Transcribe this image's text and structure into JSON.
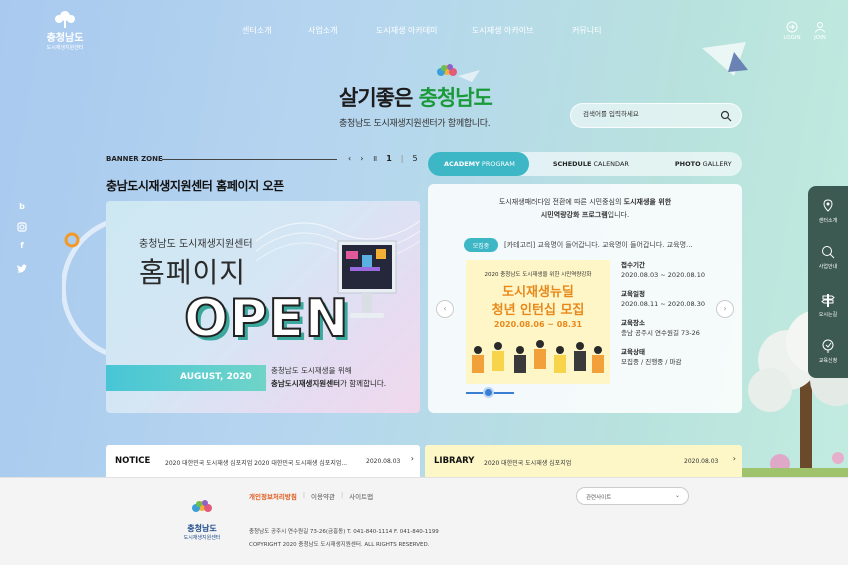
{
  "header": {
    "logo": {
      "title": "충청남도",
      "subtitle": "도시재생지원센터"
    },
    "nav": [
      "센터소개",
      "사업소개",
      "도시재생 아카데미",
      "도시재생 아카이브",
      "커뮤니티"
    ],
    "login_label": "LOGIN",
    "join_label": "JOIN"
  },
  "hero": {
    "title_prefix": "살기좋은 ",
    "title_highlight": "충청남도",
    "subtitle": "충청남도 도시재생지원센터가 함께합니다."
  },
  "search": {
    "placeholder": "검색어를 입력하세요"
  },
  "banner_zone": {
    "label": "BANNER ZONE",
    "current": "1",
    "total": "5",
    "separator": "|",
    "title": "충남도시재생지원센터 홈페이지 오픈",
    "banner": {
      "line1": "충청남도 도시재생지원센터",
      "line2": "홈페이지",
      "open": "OPEN",
      "date": "AUGUST, 2020",
      "desc1": "충청남도 도시재생을 위해",
      "desc2_bold": "충남도시재생지원센터",
      "desc2_rest": "가 함께합니다."
    }
  },
  "tabs": [
    {
      "bold": "ACADEMY",
      "rest": " PROGRAM",
      "active": true
    },
    {
      "bold": "SCHEDULE",
      "rest": " CALENDAR",
      "active": false
    },
    {
      "bold": "PHOTO",
      "rest": " GALLERY",
      "active": false
    }
  ],
  "academy": {
    "intro1_pre": "도시재생패러다임 전환에 따른 시민중심의 ",
    "intro1_bold": "도시재생을 위한",
    "intro2_bold": "시민역량강화 프로그램",
    "intro2_rest": "입니다.",
    "category_badge": "모집중",
    "category_text": "[카테고리] 교육명이 들어갑니다. 교육명이 들어갑니다. 교육명...",
    "poster": {
      "line1": "2020 충청남도 도시재생을 위한 시민역량강화",
      "line2": "도시재생뉴딜",
      "line3": "청년 인턴십 모집",
      "line4": "2020.08.06 ~ 08.31"
    },
    "info": {
      "period_label": "접수기간",
      "period_value": "2020.08.03 ~ 2020.08.10",
      "schedule_label": "교육일정",
      "schedule_value": "2020.08.11 ~ 2020.08.30",
      "place_label": "교육장소",
      "place_value": "충남 공주시 연수원길 73-26",
      "status_label": "교육상태",
      "status_value": "모집중 / 진행중 / 마감"
    },
    "prev_label": "‹",
    "next_label": "›"
  },
  "notice": {
    "label": "NOTICE",
    "text": "2020 대한민국 도시재생 심포지엄 2020 대한민국 도시재생 심포지엄...",
    "date": "2020.08.03"
  },
  "library": {
    "label": "LIBRARY",
    "text": "2020 대한민국 도시재생 심포지엄",
    "date": "2020.08.03"
  },
  "footer": {
    "logo": {
      "title": "충청남도",
      "subtitle": "도시재생지원센터"
    },
    "links": [
      "개인정보처리방침",
      "이용약관",
      "사이트맵"
    ],
    "link_sep": "|",
    "address": "충청남도 공주시 연수원길 73-26(금흥동)      T. 041-840-1114      F. 041-840-1199",
    "copyright": "COPYRIGHT 2020 충청남도 도시재생지원센터. ALL RIGHTS RESERVED.",
    "related_sites": "관련사이트"
  },
  "quick_menu": [
    "센터소개",
    "사업안내",
    "오시는길",
    "교육신청"
  ],
  "sns": [
    "blog",
    "instagram",
    "facebook",
    "twitter"
  ],
  "colors": {
    "accent": "#3db6c5",
    "poster_orange": "#e8891c",
    "privacy": "#e05a1c",
    "quick_bg": "#3d5a52"
  }
}
